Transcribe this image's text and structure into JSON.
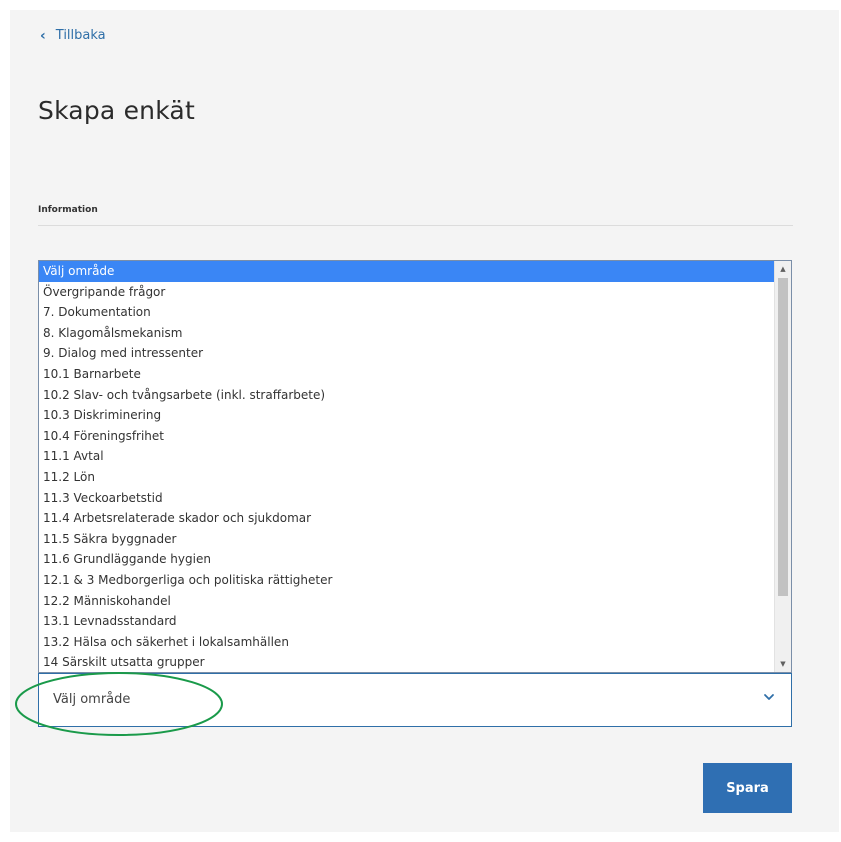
{
  "nav": {
    "back_label": "Tillbaka"
  },
  "page": {
    "title": "Skapa enkät",
    "section_label": "Information"
  },
  "area_select": {
    "value": "Välj område",
    "options": [
      "Välj område",
      "Övergripande frågor",
      "7. Dokumentation",
      "8. Klagomålsmekanism",
      "9. Dialog med intressenter",
      "10.1 Barnarbete",
      "10.2 Slav- och tvångsarbete (inkl. straffarbete)",
      "10.3 Diskriminering",
      "10.4 Föreningsfrihet",
      "11.1 Avtal",
      "11.2 Lön",
      "11.3 Veckoarbetstid",
      "11.4 Arbetsrelaterade skador och sjukdomar",
      "11.5 Säkra byggnader",
      "11.6 Grundläggande hygien",
      "12.1 & 3 Medborgerliga och politiska rättigheter",
      "12.2 Människohandel",
      "13.1 Levnadsstandard",
      "13.2 Hälsa och säkerhet i lokalsamhällen",
      "14 Särskilt utsatta grupper"
    ],
    "selected_index": 0
  },
  "actions": {
    "save_label": "Spara"
  },
  "colors": {
    "link": "#2f6fa8",
    "selected_option": "#3a86f5",
    "primary_button": "#2f6fb3",
    "annotation": "#1a9a4a"
  },
  "icons": {
    "back": "chevron-left-icon",
    "dropdown": "chevron-down-icon"
  }
}
